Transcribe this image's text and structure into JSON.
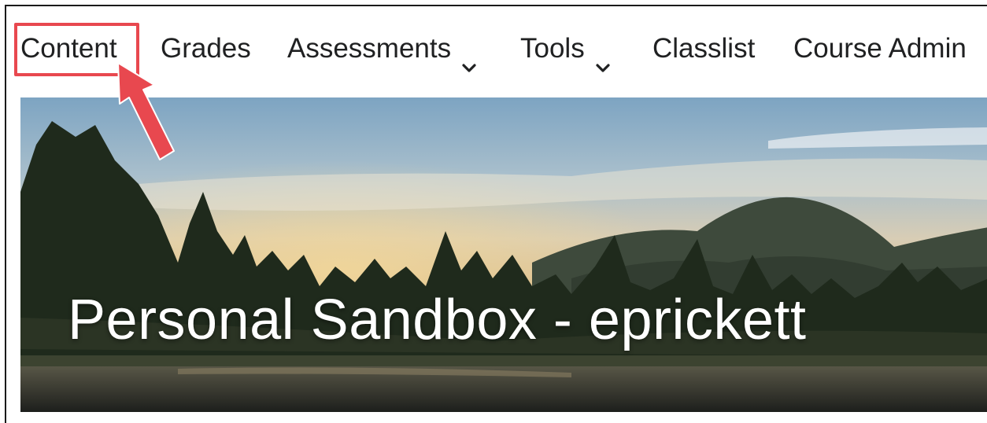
{
  "nav": {
    "items": [
      {
        "label": "Content",
        "has_dropdown": false
      },
      {
        "label": "Grades",
        "has_dropdown": false
      },
      {
        "label": "Assessments",
        "has_dropdown": true
      },
      {
        "label": "Tools",
        "has_dropdown": true
      },
      {
        "label": "Classlist",
        "has_dropdown": false
      },
      {
        "label": "Course Admin",
        "has_dropdown": false
      }
    ],
    "highlighted": "Content"
  },
  "banner": {
    "title": "Personal Sandbox - eprickett"
  },
  "colors": {
    "highlight": "#e8484f",
    "nav_text": "#202122",
    "banner_title": "#ffffff"
  },
  "icons": {
    "dropdown": "chevron-down-icon",
    "annotation": "red-arrow-icon"
  }
}
